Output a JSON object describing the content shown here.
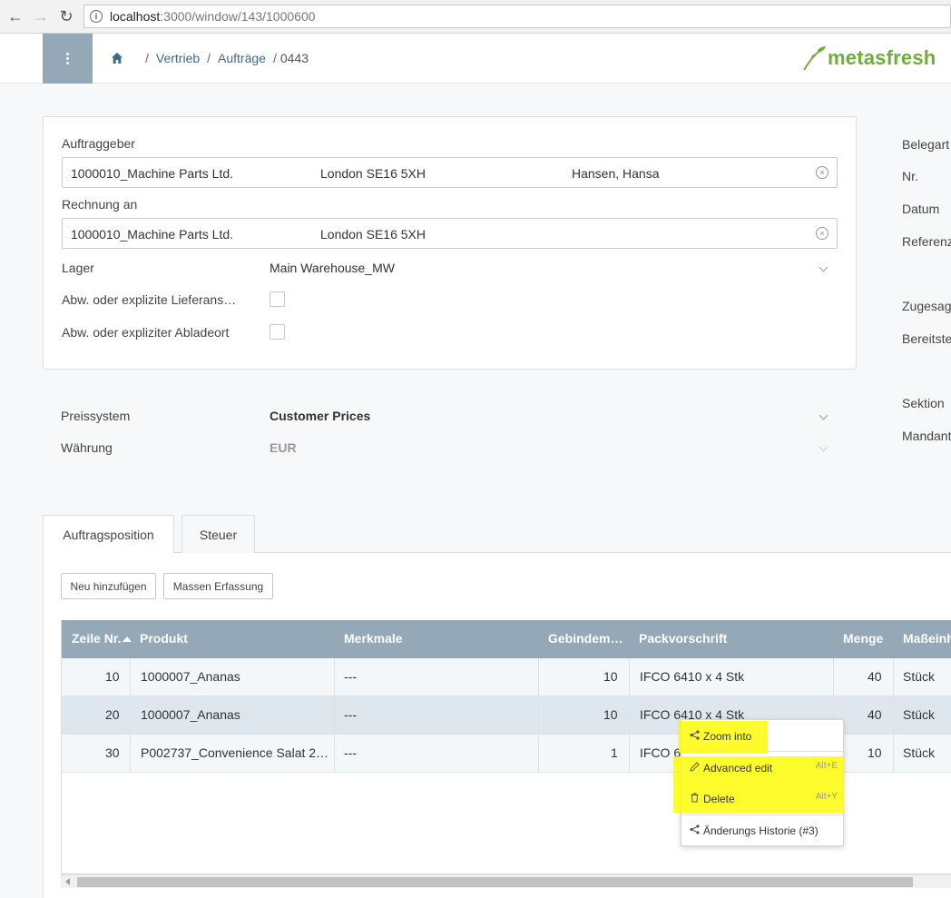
{
  "browser": {
    "url_host": "localhost",
    "url_path": ":3000/window/143/1000600"
  },
  "header": {
    "breadcrumb": [
      "Vertrieb",
      "Aufträge",
      "0443"
    ],
    "logo_text": "metasfresh",
    "brand_color": "#6fae3b"
  },
  "form": {
    "auftraggeber_label": "Auftraggeber",
    "auftraggeber": {
      "partner": "1000010_Machine Parts Ltd.",
      "location": "London SE16 5XH",
      "contact": "Hansen, Hansa"
    },
    "rechnung_label": "Rechnung an",
    "rechnung": {
      "partner": "1000010_Machine Parts Ltd.",
      "location": "London SE16 5XH"
    },
    "lager_label": "Lager",
    "lager_value": "Main Warehouse_MW",
    "abw_lieferans_label": "Abw. oder explizite Lieferans…",
    "abw_abladeort_label": "Abw. oder expliziter Abladeort",
    "preissystem_label": "Preissystem",
    "preissystem_value": "Customer Prices",
    "waehrung_label": "Währung",
    "waehrung_value": "EUR"
  },
  "side_labels": [
    "Belegart",
    "Nr.",
    "Datum",
    "Referenz",
    "Zugesag",
    "Bereitste",
    "Sektion",
    "Mandant"
  ],
  "tabs": [
    {
      "label": "Auftragsposition",
      "active": true
    },
    {
      "label": "Steuer",
      "active": false
    }
  ],
  "actions": {
    "add_new": "Neu hinzufügen",
    "batch_entry": "Massen Erfassung"
  },
  "table": {
    "columns": [
      "Zeile Nr.",
      "Produkt",
      "Merkmale",
      "Gebindem…",
      "Packvorschrift",
      "Menge",
      "Maßeinh"
    ],
    "rows": [
      {
        "line": "10",
        "product": "1000007_Ananas",
        "attributes": "---",
        "packs": "10",
        "packing": "IFCO 6410 x 4 Stk",
        "qty": "40",
        "uom": "Stück"
      },
      {
        "line": "20",
        "product": "1000007_Ananas",
        "attributes": "---",
        "packs": "10",
        "packing": "IFCO 6410 x 4 Stk",
        "qty": "40",
        "uom": "Stück"
      },
      {
        "line": "30",
        "product": "P002737_Convenience Salat 2…",
        "attributes": "---",
        "packs": "1",
        "packing": "IFCO 64",
        "qty": "10",
        "uom": "Stück"
      }
    ]
  },
  "context_menu": {
    "zoom_into": "Zoom into",
    "advanced_edit": "Advanced edit",
    "advanced_edit_shortcut": "Alt+E",
    "delete": "Delete",
    "delete_shortcut": "Alt+Y",
    "history": "Änderungs Historie (#3)"
  }
}
